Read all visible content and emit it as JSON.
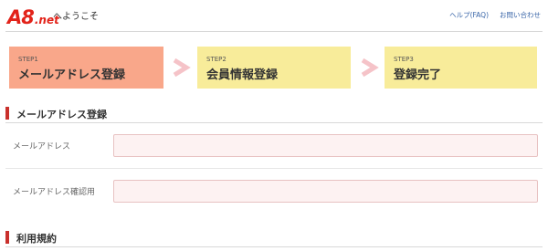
{
  "header": {
    "logo_main": "A8",
    "logo_sub": ".net",
    "welcome": "へようこそ",
    "help_link": "ヘルプ(FAQ)",
    "contact_link": "お問い合わせ"
  },
  "steps": [
    {
      "num": "STEP1",
      "title": "メールアドレス登録",
      "color": "#f9a78a",
      "active": true
    },
    {
      "num": "STEP2",
      "title": "会員情報登録",
      "color": "#f8ec9a",
      "active": false
    },
    {
      "num": "STEP3",
      "title": "登録完了",
      "color": "#f8ec9a",
      "active": false
    }
  ],
  "sections": {
    "mail_title": "メールアドレス登録",
    "terms_title": "利用規約"
  },
  "form": {
    "email_label": "メールアドレス",
    "email_value": "",
    "email_confirm_label": "メールアドレス確認用",
    "email_confirm_value": ""
  },
  "colors": {
    "brand": "#e2231a",
    "section_bar": "#c9302c",
    "arrow": "#f5c3c8",
    "input_bg": "#fdf2f2"
  },
  "icons": {
    "step_arrow": "chevron-right-icon"
  }
}
